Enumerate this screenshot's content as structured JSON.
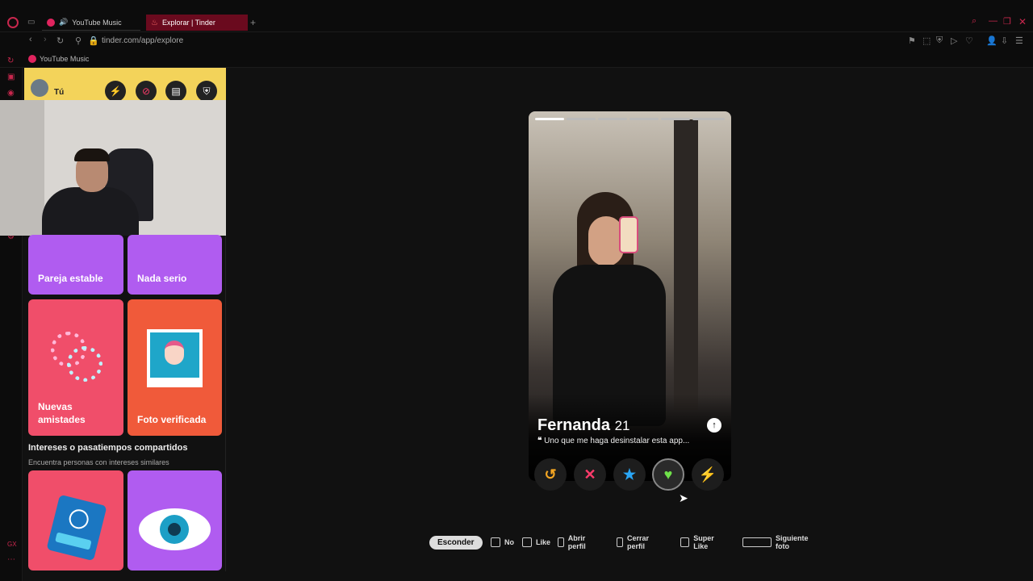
{
  "browser": {
    "tabs": [
      {
        "label": "YouTube Music"
      },
      {
        "label": "Explorar | Tinder"
      }
    ],
    "url": "tinder.com/app/explore",
    "bookmark": "YouTube Music"
  },
  "sidebar": {
    "user_label": "Tú",
    "cards_top": [
      {
        "label": "Pareja estable",
        "color": "#b05cf0"
      },
      {
        "label": "Nada serio",
        "color": "#b05cf0"
      }
    ],
    "cards_mid": [
      {
        "label": "Nuevas amistades",
        "color": "#f04e6a"
      },
      {
        "label": "Foto verificada",
        "color": "#f05a3a"
      }
    ],
    "section_title": "Intereses o pasatiempos compartidos",
    "section_subtitle": "Encuentra personas con intereses similares",
    "cards_bottom": [
      {
        "color": "#f04e6a",
        "icon": "passport-icon"
      },
      {
        "color": "#b05cf0",
        "icon": "eye-icon"
      }
    ]
  },
  "profile": {
    "name": "Fernanda",
    "age": "21",
    "bio": "Uno que me haga desinstalar esta app..."
  },
  "actions": [
    {
      "name": "rewind-button",
      "glyph": "↺",
      "color": "#f5a623"
    },
    {
      "name": "nope-button",
      "glyph": "✕",
      "color": "#ff3b6b"
    },
    {
      "name": "superlike-button",
      "glyph": "★",
      "color": "#2aa6f5"
    },
    {
      "name": "like-button",
      "glyph": "♥",
      "color": "#6fe04a"
    },
    {
      "name": "boost-button",
      "glyph": "⚡",
      "color": "#b05cf0"
    }
  ],
  "hints": {
    "hide": "Esconder",
    "no": "No",
    "like": "Like",
    "open": "Abrir perfil",
    "close": "Cerrar perfil",
    "super": "Super Like",
    "next": "Siguiente foto"
  }
}
